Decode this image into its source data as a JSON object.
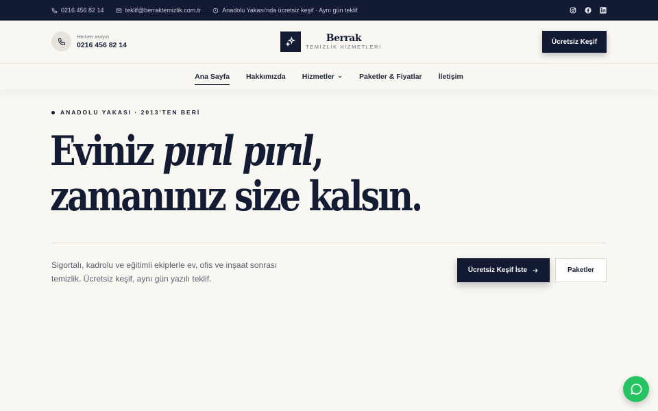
{
  "topbar": {
    "phone": "0216 456 82 14",
    "email": "teklif@berraktemizlik.com.tr",
    "notice": "Anadolu Yakası'nda ücretsiz keşif · Aynı gün teklif"
  },
  "header": {
    "call_label": "Hemen arayın",
    "call_number": "0216 456 82 14",
    "brand": "Berrak",
    "brand_sub": "TEMİZLİK HİZMETLERİ",
    "cta": "Ücretsiz Keşif"
  },
  "nav": {
    "items": [
      {
        "label": "Ana Sayfa"
      },
      {
        "label": "Hakkımızda"
      },
      {
        "label": "Hizmetler"
      },
      {
        "label": "Paketler & Fiyatlar"
      },
      {
        "label": "İletişim"
      }
    ]
  },
  "hero": {
    "eyebrow": "ANADOLU YAKASI · 2013'TEN BERİ",
    "headline_part1": "Eviniz ",
    "headline_italic": "pırıl pırıl",
    "headline_part2": ",",
    "headline_line2": "zamanınız size kalsın.",
    "description": "Sigortalı, kadrolu ve eğitimli ekiplerle ev, ofis ve inşaat sonrası temizlik. Ücretsiz keşif, aynı gün yazılı teklif.",
    "primary_cta": "Ücretsiz Keşif İste",
    "secondary_cta": "Paketler"
  },
  "colors": {
    "navy": "#131a33",
    "background": "#f9f7f2",
    "whatsapp": "#25c361"
  },
  "icons": {
    "topbar": [
      "phone-icon",
      "mail-icon",
      "clock-icon"
    ],
    "social": [
      "instagram-icon",
      "facebook-icon",
      "linkedin-icon"
    ],
    "logo": "sparkle-icon",
    "floating": "whatsapp-icon"
  }
}
